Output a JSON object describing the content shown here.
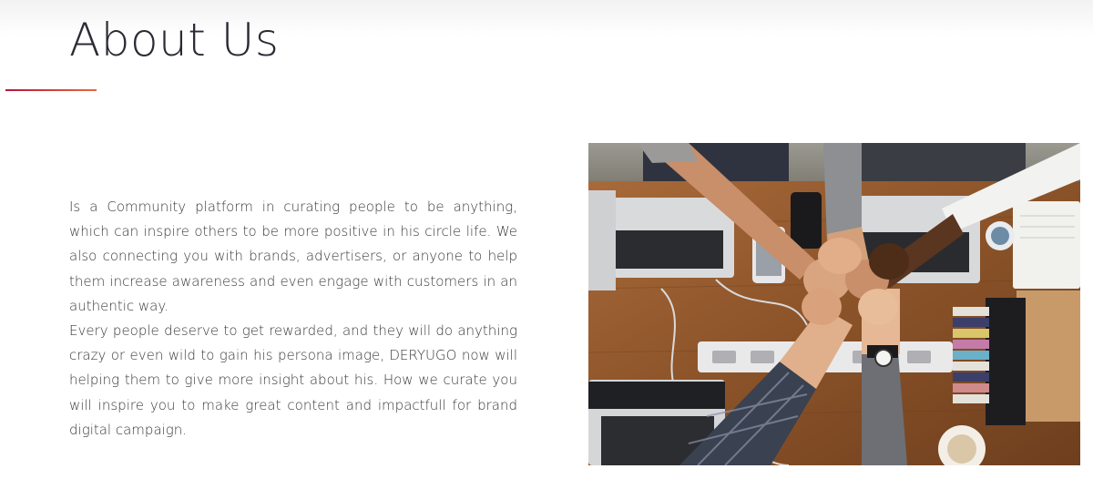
{
  "header": {
    "title": "About Us"
  },
  "about": {
    "paragraph_1": "Is a Community platform in curating people to be anything, which can inspire others to be more positive in his circle life. We also connecting you with brands, advertisers, or anyone to help them increase awareness and even engage with customers in an authentic way.",
    "paragraph_2": "Every people deserve to get rewarded, and they will do anything crazy or even wild to gain his persona image, DERYUGO now will helping them to give more insight about his. How we curate you will inspire you to make great content and impactfull for brand digital campaign."
  },
  "image": {
    "subject": "team-fist-bump-over-desk-photo"
  },
  "colors": {
    "title": "#2b2b35",
    "text": "#3a3a3a",
    "divider_start": "#b8143c",
    "divider_end": "#e56a3c",
    "desk": "#8a5a32"
  }
}
